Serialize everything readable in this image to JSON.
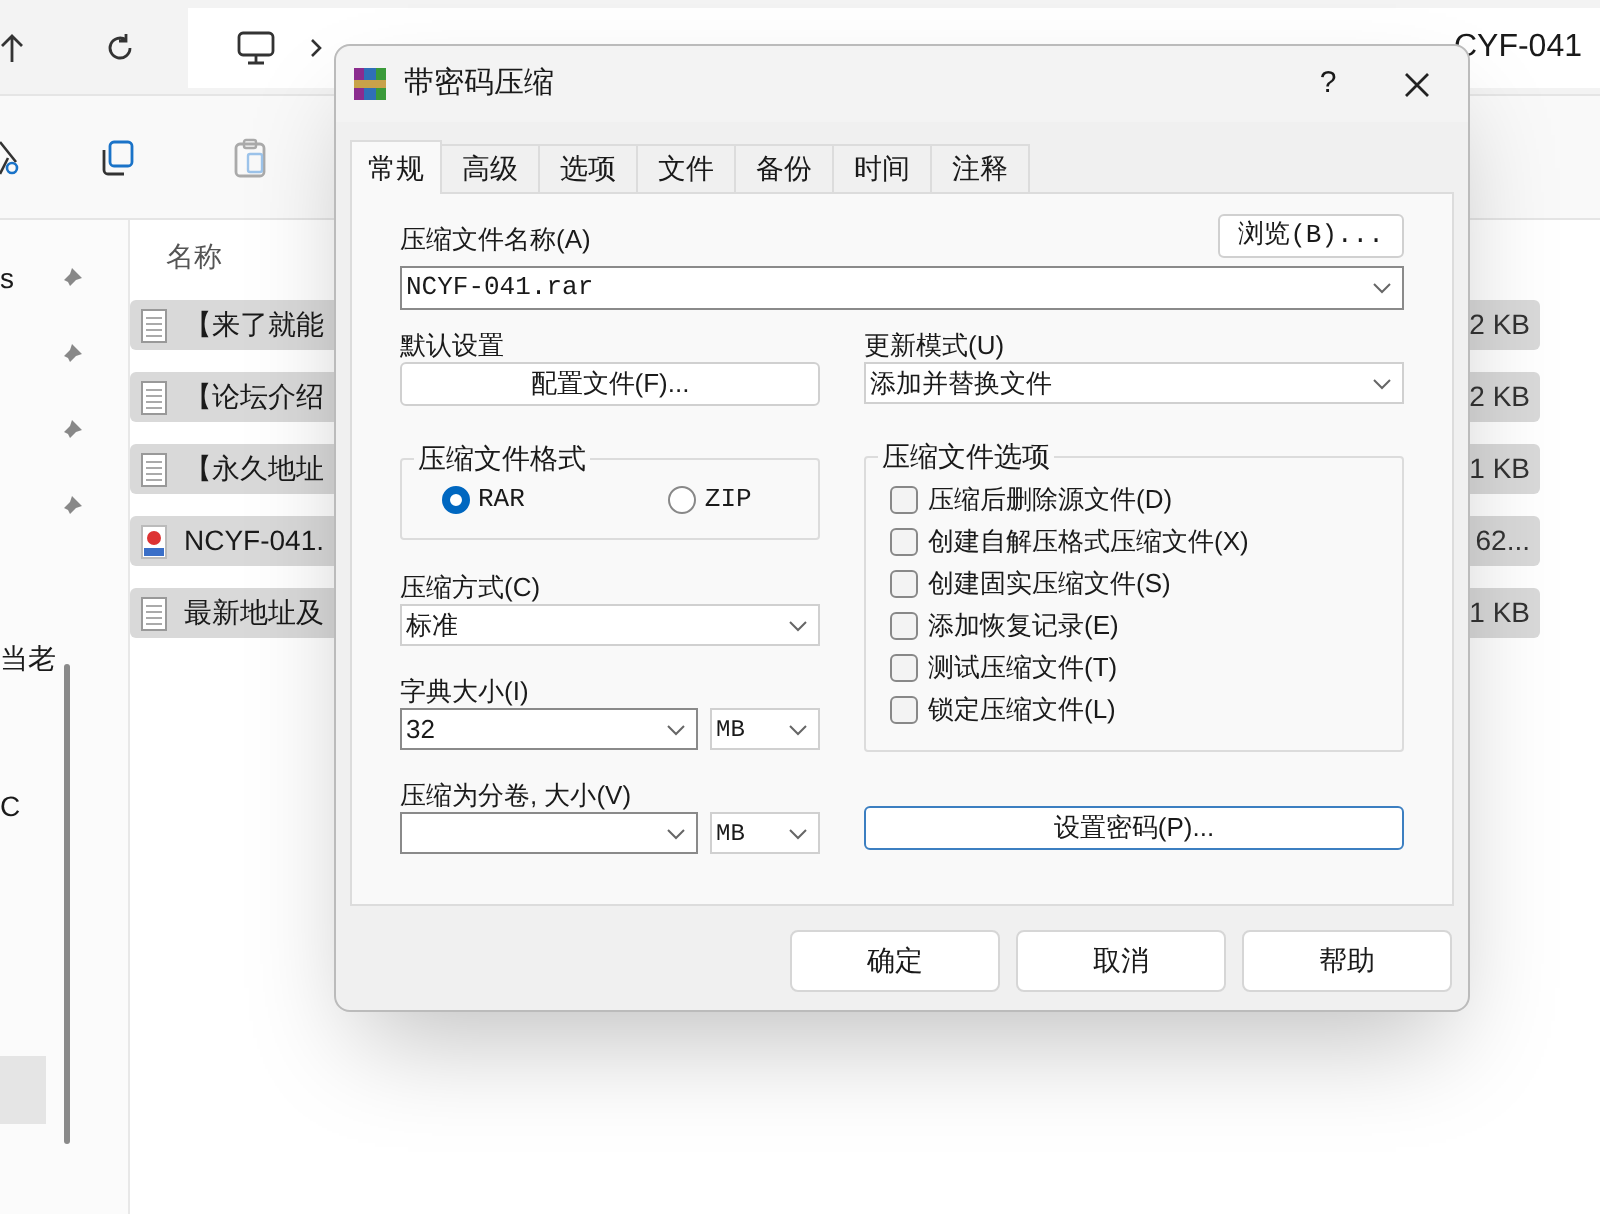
{
  "explorer": {
    "breadcrumb_end": "CYF-041",
    "sidebar_items": [
      {
        "label": "s",
        "pinned": true
      },
      {
        "pinned": true
      },
      {
        "pinned": true
      },
      {
        "pinned": true
      },
      {
        "label": "当老",
        "pinned": false
      },
      {
        "label": "C",
        "pinned": false
      }
    ],
    "column_header": "名称",
    "files": [
      {
        "name": "【来了就能",
        "size": "2 KB",
        "kind": "text"
      },
      {
        "name": "【论坛介绍",
        "size": "2 KB",
        "kind": "text"
      },
      {
        "name": "【永久地址",
        "size": "1 KB",
        "kind": "text"
      },
      {
        "name": "NCYF-041.",
        "size": "62...",
        "kind": "archive"
      },
      {
        "name": "最新地址及",
        "size": "1 KB",
        "kind": "text"
      }
    ]
  },
  "dialog": {
    "title": "带密码压缩",
    "help": "?",
    "tabs": [
      {
        "label": "常规",
        "selected": true
      },
      {
        "label": "高级",
        "selected": false
      },
      {
        "label": "选项",
        "selected": false
      },
      {
        "label": "文件",
        "selected": false
      },
      {
        "label": "备份",
        "selected": false
      },
      {
        "label": "时间",
        "selected": false
      },
      {
        "label": "注释",
        "selected": false
      }
    ],
    "archive_name": {
      "label": "压缩文件名称(A)",
      "value": "NCYF-041.rar",
      "browse": "浏览(B)..."
    },
    "default_settings": {
      "label": "默认设置",
      "button": "配置文件(F)..."
    },
    "update_mode": {
      "label": "更新模式(U)",
      "value": "添加并替换文件"
    },
    "archive_format": {
      "title": "压缩文件格式",
      "options": [
        {
          "label": "RAR",
          "selected": true
        },
        {
          "label": "ZIP",
          "selected": false
        }
      ]
    },
    "compression_method": {
      "label": "压缩方式(C)",
      "value": "标准"
    },
    "dictionary_size": {
      "label": "字典大小(I)",
      "value": "32",
      "unit": "MB"
    },
    "split_volumes": {
      "label": "压缩为分卷, 大小(V)",
      "unit": "MB"
    },
    "archive_options": {
      "title": "压缩文件选项",
      "options": [
        {
          "label": "压缩后删除源文件(D)",
          "checked": false
        },
        {
          "label": "创建自解压格式压缩文件(X)",
          "checked": false
        },
        {
          "label": "创建固实压缩文件(S)",
          "checked": false
        },
        {
          "label": "添加恢复记录(E)",
          "checked": false
        },
        {
          "label": "测试压缩文件(T)",
          "checked": false
        },
        {
          "label": "锁定压缩文件(L)",
          "checked": false
        }
      ]
    },
    "password_button": "设置密码(P)...",
    "buttons": [
      "确定",
      "取消",
      "帮助"
    ]
  }
}
